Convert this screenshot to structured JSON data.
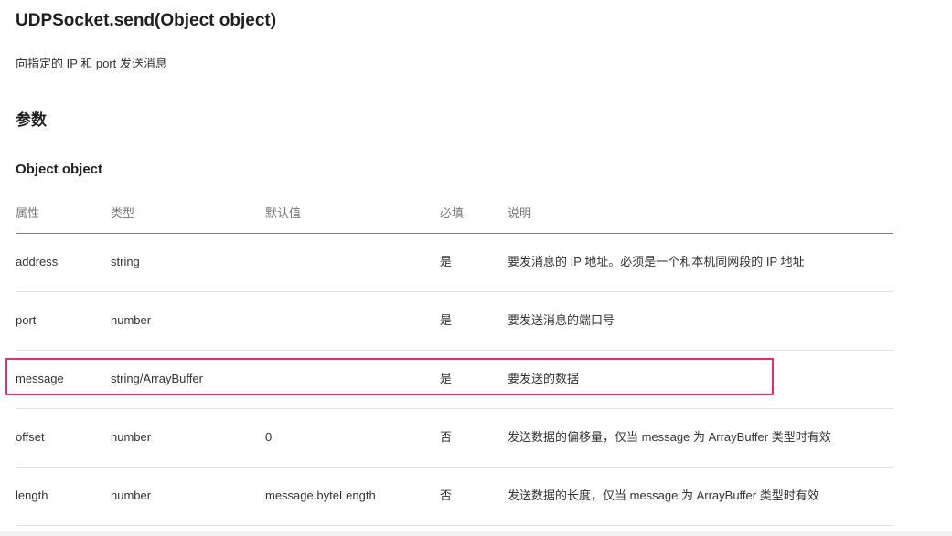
{
  "title": "UDPSocket.send(Object object)",
  "description": "向指定的 IP 和 port 发送消息",
  "params_heading": "参数",
  "object_heading": "Object object",
  "table": {
    "headers": [
      "属性",
      "类型",
      "默认值",
      "必填",
      "说明"
    ],
    "rows": [
      [
        "address",
        "string",
        "",
        "是",
        "要发消息的 IP 地址。必须是一个和本机同网段的 IP 地址"
      ],
      [
        "port",
        "number",
        "",
        "是",
        "要发送消息的端口号"
      ],
      [
        "message",
        "string/ArrayBuffer",
        "",
        "是",
        "要发送的数据"
      ],
      [
        "offset",
        "number",
        "0",
        "否",
        "发送数据的偏移量，仅当 message 为 ArrayBuffer 类型时有效"
      ],
      [
        "length",
        "number",
        "message.byteLength",
        "否",
        "发送数据的长度，仅当 message 为 ArrayBuffer 类型时有效"
      ]
    ]
  },
  "highlight_color": "#f0266e"
}
